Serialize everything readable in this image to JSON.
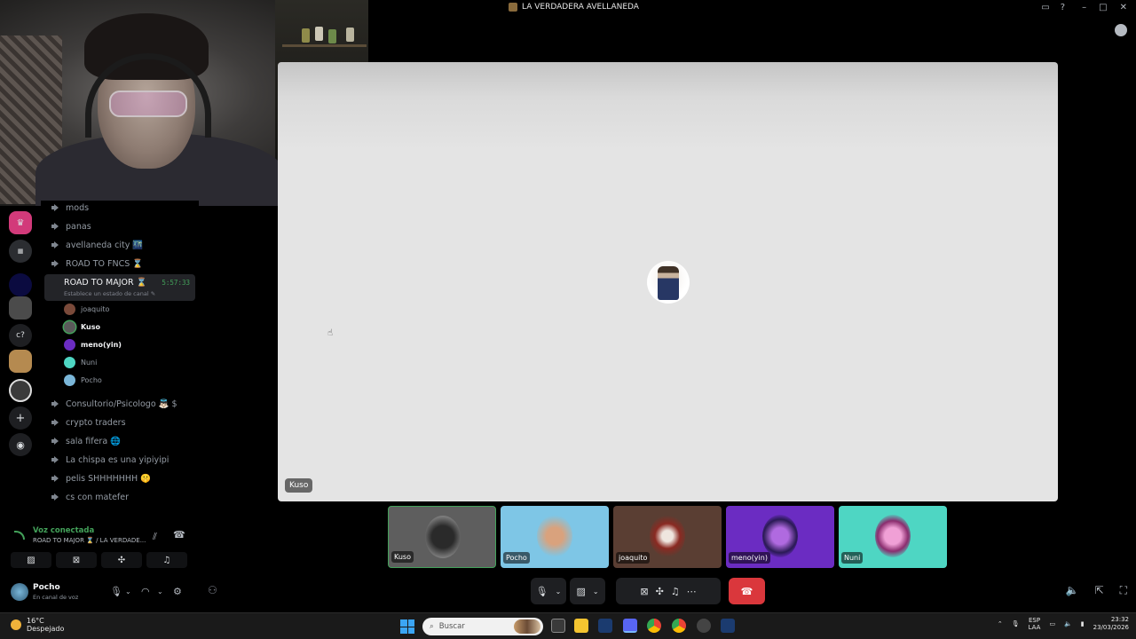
{
  "window": {
    "title": "LA VERDADERA AVELLANEDA"
  },
  "channels": [
    {
      "name": "mods"
    },
    {
      "name": "panas"
    },
    {
      "name": "avellaneda city 🌃"
    },
    {
      "name": "ROAD TO FNCS ⌛"
    },
    {
      "name": "Consultorio/Psicologo 👼🏻 $"
    },
    {
      "name": "crypto traders"
    },
    {
      "name": "sala fifera 🌐"
    },
    {
      "name": "La chispa es una yipiyipi"
    },
    {
      "name": "pelis SHHHHHHH 🤫"
    },
    {
      "name": "cs con matefer"
    }
  ],
  "active_channel": {
    "name": "ROAD TO MAJOR ⌛",
    "timer": "5:57:33",
    "status": "Establece un estado de canal ✎",
    "members": [
      "joaquito",
      "Kuso",
      "meno(yin)",
      "Nuni",
      "Pocho"
    ]
  },
  "voice_panel": {
    "status": "Voz conectada",
    "channel": "ROAD TO MAJOR ⌛ / LA VERDADE..."
  },
  "user": {
    "name": "Pocho",
    "status": "En canal de voz"
  },
  "stage": {
    "speaker_label": "Kuso"
  },
  "tiles": [
    {
      "label": "Kuso",
      "color": "#6a6a6a"
    },
    {
      "label": "Pocho",
      "color": "#7ec6e6"
    },
    {
      "label": "joaquito",
      "color": "#5a3e33"
    },
    {
      "label": "meno(yin)",
      "color": "#6b2cc2"
    },
    {
      "label": "Nuni",
      "color": "#4ed6c3"
    }
  ],
  "taskbar": {
    "weather_temp": "16°C",
    "weather_desc": "Despejado",
    "search_placeholder": "Buscar",
    "lang_top": "ESP",
    "lang_bottom": "LAA",
    "time": "23:32",
    "date": "23/03/2026"
  },
  "colors": {
    "accent_green": "#43a25a",
    "hangup_red": "#da373c"
  }
}
